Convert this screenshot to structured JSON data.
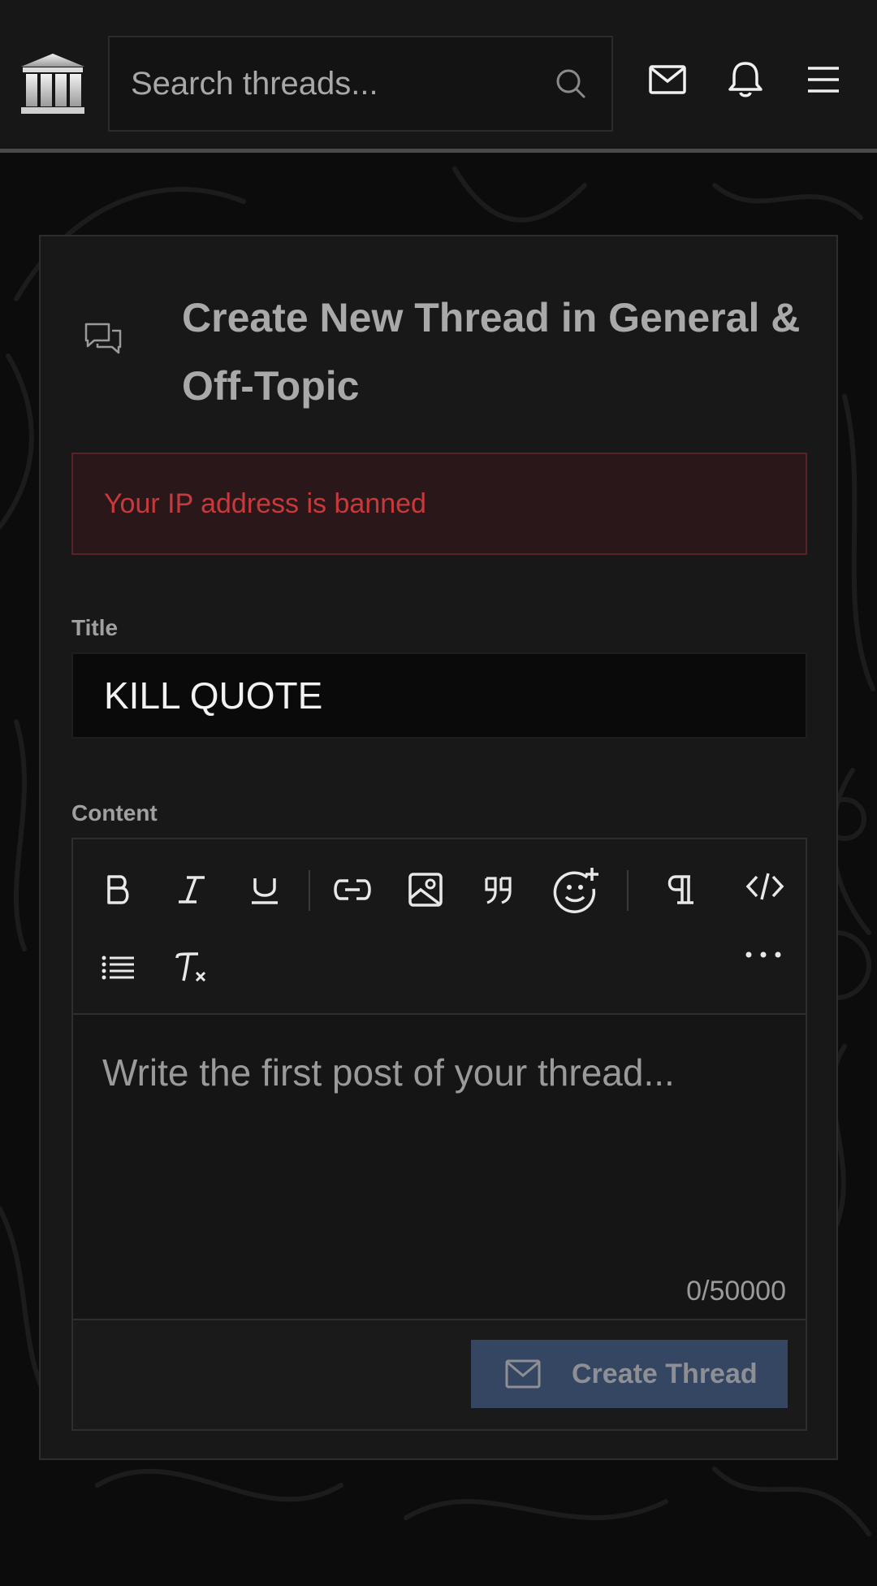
{
  "header": {
    "logo_icon": "bank-columns-icon",
    "search": {
      "placeholder": "Search threads..."
    },
    "icons": [
      "mail-icon",
      "bell-icon",
      "menu-icon"
    ]
  },
  "page": {
    "title": "Create New Thread in General & Off-Topic",
    "title_icon": "chat-bubbles-icon",
    "alert": "Your IP address is banned",
    "colors": {
      "alert_text": "#c8393c",
      "button_bg": "#344661"
    }
  },
  "form": {
    "title_label": "Title",
    "title_value": "KILL QUOTE",
    "content_label": "Content",
    "content_placeholder": "Write the first post of your thread...",
    "char_count": "0/50000",
    "toolbar": [
      "bold-icon",
      "italic-icon",
      "underline-icon",
      "link-icon",
      "image-icon",
      "quote-icon",
      "emoji-icon",
      "paragraph-icon",
      "code-icon",
      "list-icon",
      "clear-format-icon",
      "more-icon"
    ],
    "submit_label": "Create Thread"
  }
}
